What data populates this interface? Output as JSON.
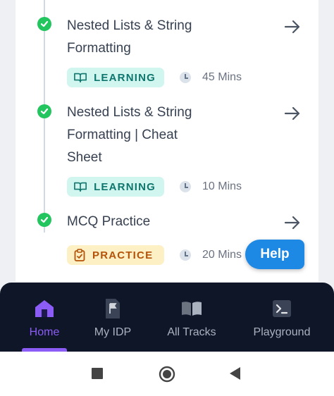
{
  "items": [
    {
      "title_lines": [
        "Nested Lists & String",
        "Formatting"
      ],
      "badge": "LEARNING",
      "time": "45 Mins"
    },
    {
      "title_lines": [
        "Nested Lists & String",
        "Formatting | Cheat",
        "Sheet"
      ],
      "badge": "LEARNING",
      "time": "10 Mins"
    },
    {
      "title_lines": [
        "MCQ Practice"
      ],
      "badge": "PRACTICE",
      "time": "20 Mins"
    }
  ],
  "help": {
    "label": "Help"
  },
  "bottom_nav": [
    {
      "label": "Home",
      "icon": "home-icon",
      "active": true
    },
    {
      "label": "My IDP",
      "icon": "flag-document-icon",
      "active": false
    },
    {
      "label": "All Tracks",
      "icon": "open-book-icon",
      "active": false
    },
    {
      "label": "Playground",
      "icon": "terminal-icon",
      "active": false
    }
  ],
  "system_nav": [
    "square-recents-icon",
    "circle-home-icon",
    "triangle-back-icon"
  ],
  "colors": {
    "check_green": "#22c55e",
    "learning_bg": "#d1f5ef",
    "learning_text": "#0f766e",
    "practice_bg": "#fdf0c4",
    "practice_text": "#b45309",
    "help_blue": "#1e88e5",
    "nav_bg": "#0f1628",
    "nav_active": "#8b5cf6"
  }
}
